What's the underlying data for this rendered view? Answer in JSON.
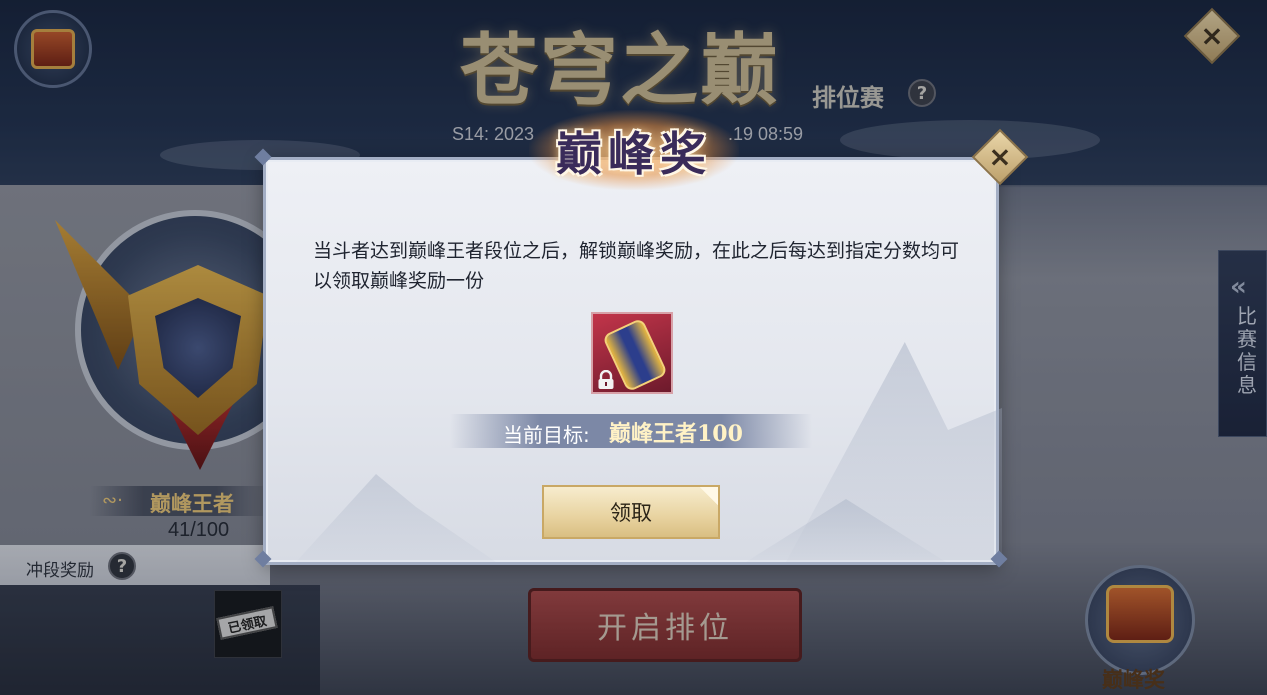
{
  "header": {
    "event_title": "苍穹之巅",
    "subtitle": "排位赛",
    "help_symbol": "?",
    "season_left": "S14: 2023",
    "season_right": ".19 08:59"
  },
  "left_panel": {
    "rank_name": "巅峰王者",
    "rank_progress": "41/100",
    "climb_reward_label": "冲段奖励",
    "claimed_stamp": "已领取"
  },
  "bottom": {
    "start_button": "开启排位",
    "chest_label": "巅峰奖"
  },
  "side_tab": {
    "label": "比赛信息"
  },
  "modal": {
    "title": "巅峰奖",
    "description": "当斗者达到巅峰王者段位之后，解锁巅峰奖励，在此之后每达到指定分数均可以领取巅峰奖励一份",
    "target_label": "当前目标:",
    "target_value": "巅峰王者100",
    "claim_button": "领取",
    "close_symbol": "×"
  },
  "main_close_symbol": "×",
  "colors": {
    "gold": "#e8c677",
    "modal_bg": "#e4e7ee",
    "start_button": "#a84848",
    "claim_button": "#e8d3a0"
  }
}
